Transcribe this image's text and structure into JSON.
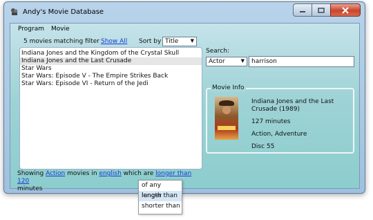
{
  "window": {
    "title": "Andy's Movie Database",
    "icon": "film-reel-icon",
    "controls": {
      "minimize": "minimize-icon",
      "maximize": "maximize-icon",
      "close": "close-icon"
    }
  },
  "menubar": {
    "items": [
      "Program",
      "Movie"
    ]
  },
  "filter_bar": {
    "count_text": "5 movies matching filter",
    "show_all": "Show All",
    "sort_label": "Sort by",
    "sort_value": "Title"
  },
  "movie_list": {
    "items": [
      "Indiana Jones and the Kingdom of the Crystal Skull",
      "Indiana Jones and the Last Crusade",
      "Star Wars",
      "Star Wars: Episode V - The Empire Strikes Back",
      "Star Wars: Episode VI - Return of the Jedi"
    ],
    "selected_index": 1
  },
  "search": {
    "label": "Search:",
    "field_type": "Actor",
    "query": "harrison"
  },
  "movie_info": {
    "legend": "Movie Info",
    "title": "Indiana Jones and the Last Crusade",
    "year": "(1989)",
    "runtime": "127 minutes",
    "genres": "Action, Adventure",
    "disc": "Disc 55"
  },
  "filter_sentence": {
    "showing": "Showing",
    "genre": "Action",
    "movies_in": "movies in",
    "language": "english",
    "which_are": "which are",
    "comparison": "longer than",
    "length": "120",
    "minutes": "minutes"
  },
  "length_dropdown": {
    "options": [
      "of any length",
      "longer than",
      "shorter than"
    ],
    "highlighted": "longer than"
  },
  "colors": {
    "link": "#1a3bd6",
    "selection": "#e6e6e6",
    "close_button": "#c7452c"
  }
}
